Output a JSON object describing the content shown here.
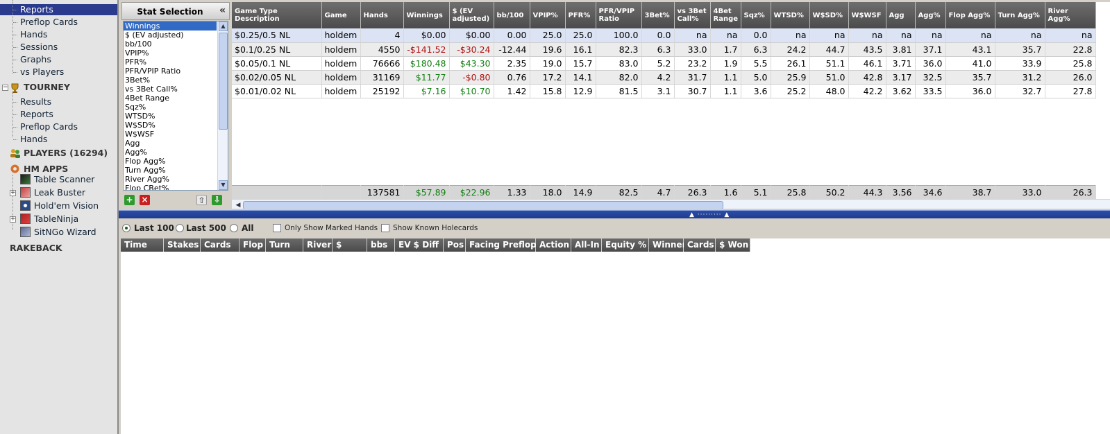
{
  "nav": {
    "cash_items": [
      "Reports",
      "Preflop Cards",
      "Hands",
      "Sessions",
      "Graphs",
      "vs Players"
    ],
    "tourney_title": "TOURNEY",
    "tourney_items": [
      "Results",
      "Reports",
      "Preflop Cards",
      "Hands"
    ],
    "players_title": "PLAYERS (16294)",
    "apps_title": "HM APPS",
    "apps": [
      "Table Scanner",
      "Leak Buster",
      "Hold'em Vision",
      "TableNinja",
      "SitNGo Wizard"
    ],
    "rakeback": "RAKEBACK"
  },
  "stat_selection": {
    "title": "Stat Selection",
    "collapse": "«",
    "items": [
      "Winnings",
      "$ (EV adjusted)",
      "bb/100",
      "VPIP%",
      "PFR%",
      "PFR/VPIP Ratio",
      "3Bet%",
      "vs 3Bet Call%",
      "4Bet Range",
      "Sqz%",
      "WTSD%",
      "W$SD%",
      "W$WSF",
      "Agg",
      "Agg%",
      "Flop Agg%",
      "Turn Agg%",
      "River Agg%",
      "Flop CBet%"
    ],
    "toolbar": {
      "add": "+",
      "remove": "×",
      "move_up": "⇧",
      "move_down": "⇩"
    }
  },
  "grid": {
    "columns": [
      "Game Type Description",
      "Game",
      "Hands",
      "Winnings",
      "$ (EV adjusted)",
      "bb/100",
      "VPIP%",
      "PFR%",
      "PFR/VPIP Ratio",
      "3Bet%",
      "vs 3Bet Call%",
      "4Bet Range",
      "Sqz%",
      "WTSD%",
      "W$SD%",
      "W$WSF",
      "Agg",
      "Agg%",
      "Flop Agg%",
      "Turn Agg%",
      "River Agg%"
    ],
    "rows": [
      [
        "$0.25/0.5 NL",
        "holdem",
        "4",
        "$0.00",
        "$0.00",
        "0.00",
        "25.0",
        "25.0",
        "100.0",
        "0.0",
        "na",
        "na",
        "0.0",
        "na",
        "na",
        "na",
        "na",
        "na",
        "na",
        "na",
        "na"
      ],
      [
        "$0.1/0.25 NL",
        "holdem",
        "4550",
        "-$141.52",
        "-$30.24",
        "-12.44",
        "19.6",
        "16.1",
        "82.3",
        "6.3",
        "33.0",
        "1.7",
        "6.3",
        "24.2",
        "44.7",
        "43.5",
        "3.81",
        "37.1",
        "43.1",
        "35.7",
        "22.8"
      ],
      [
        "$0.05/0.1 NL",
        "holdem",
        "76666",
        "$180.48",
        "$43.30",
        "2.35",
        "19.0",
        "15.7",
        "83.0",
        "5.2",
        "23.2",
        "1.9",
        "5.5",
        "26.1",
        "51.1",
        "46.1",
        "3.71",
        "36.0",
        "41.0",
        "33.9",
        "25.8"
      ],
      [
        "$0.02/0.05 NL",
        "holdem",
        "31169",
        "$11.77",
        "-$0.80",
        "0.76",
        "17.2",
        "14.1",
        "82.0",
        "4.2",
        "31.7",
        "1.1",
        "5.0",
        "25.9",
        "51.0",
        "42.8",
        "3.17",
        "32.5",
        "35.7",
        "31.2",
        "26.0"
      ],
      [
        "$0.01/0.02 NL",
        "holdem",
        "25192",
        "$7.16",
        "$10.70",
        "1.42",
        "15.8",
        "12.9",
        "81.5",
        "3.1",
        "30.7",
        "1.1",
        "3.6",
        "25.2",
        "48.0",
        "42.2",
        "3.62",
        "33.5",
        "36.0",
        "32.7",
        "27.8"
      ]
    ],
    "totals": [
      "",
      "",
      "137581",
      "$57.89",
      "$22.96",
      "1.33",
      "18.0",
      "14.9",
      "82.5",
      "4.7",
      "26.3",
      "1.6",
      "5.1",
      "25.8",
      "50.2",
      "44.3",
      "3.56",
      "34.6",
      "38.7",
      "33.0",
      "26.3"
    ]
  },
  "filters": {
    "last100": "Last 100",
    "last500": "Last 500",
    "all": "All",
    "marked": "Only Show Marked Hands",
    "holecards": "Show Known Holecards",
    "selected": "last100"
  },
  "hands_columns": [
    "Time",
    "Stakes",
    "Cards",
    "Flop",
    "Turn",
    "River",
    "$",
    "bbs",
    "EV $ Diff",
    "Pos",
    "Facing Preflop",
    "Action",
    "All-In",
    "Equity %",
    "Winner",
    "Cards",
    "$ Won"
  ],
  "colors": {
    "selection": "#2a3a8c",
    "negative": "#b01010",
    "positive": "#108010",
    "splitter": "#1f3c8c"
  }
}
